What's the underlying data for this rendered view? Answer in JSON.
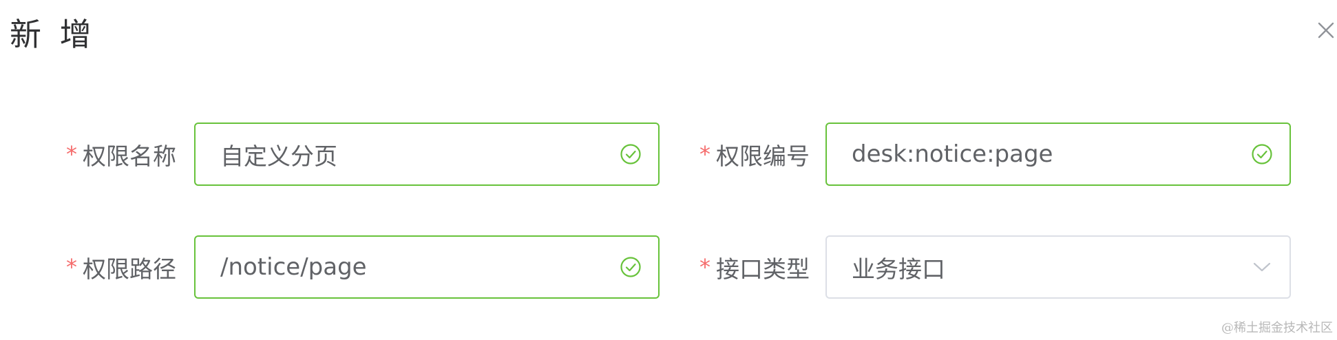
{
  "dialog": {
    "title": "新 增",
    "close_icon": "close-icon"
  },
  "form": {
    "required_mark": "*",
    "fields": [
      {
        "label": "权限名称",
        "value": "自定义分页",
        "control": "text-input",
        "status": "success",
        "status_icon": "circle-check-icon"
      },
      {
        "label": "权限编号",
        "value": "desk:notice:page",
        "control": "text-input",
        "status": "success",
        "status_icon": "circle-check-icon"
      },
      {
        "label": "权限路径",
        "value": "/notice/page",
        "control": "text-input",
        "status": "success",
        "status_icon": "circle-check-icon"
      },
      {
        "label": "接口类型",
        "value": "业务接口",
        "control": "select",
        "status": "default",
        "status_icon": "chevron-down-icon"
      }
    ]
  },
  "watermark": "@稀土掘金技术社区",
  "colors": {
    "required": "#f56c6c",
    "success_border": "#67c23a",
    "default_border": "#dcdfe6",
    "label_text": "#606266",
    "title_text": "#303133"
  }
}
